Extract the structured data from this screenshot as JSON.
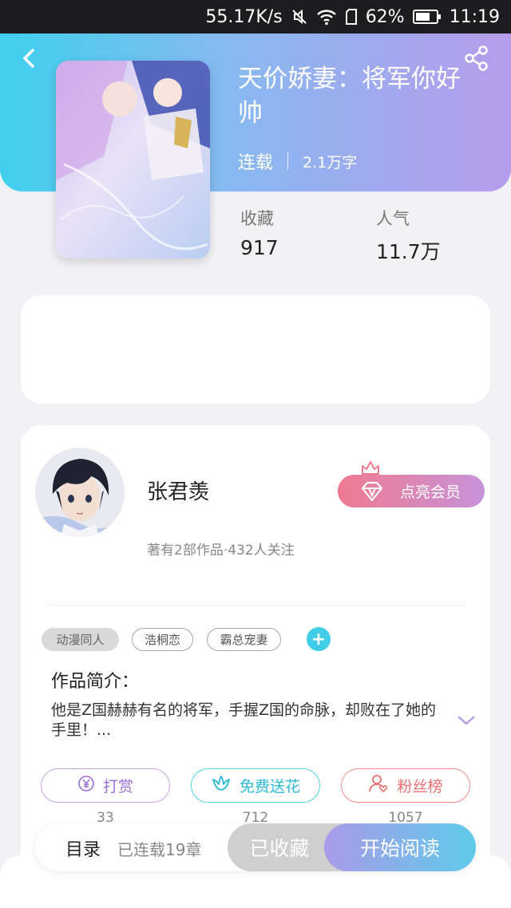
{
  "status_bar": {
    "speed": "55.17K/s",
    "battery_percent": "62%",
    "time": "11:19",
    "icons": [
      "mute-icon",
      "wifi-icon",
      "sim-icon",
      "battery-icon"
    ]
  },
  "header": {
    "back_icon": "back-arrow-icon",
    "share_icon": "share-icon",
    "cover_alt": "将军你好帅"
  },
  "book": {
    "title": "天价娇妻：将军你好帅",
    "status": "连载",
    "word_count": "2.1万字",
    "stats": [
      {
        "label": "收藏",
        "value": "917"
      },
      {
        "label": "人气",
        "value": "11.7万"
      }
    ]
  },
  "author": {
    "name": "张君羡",
    "meta": "著有2部作品·432人关注",
    "vip_button": "点亮会员"
  },
  "tags": [
    "动漫同人",
    "浩桐恋",
    "霸总宠妻"
  ],
  "tag_add": "+",
  "intro": {
    "title": "作品简介：",
    "text": "他是Z国赫赫有名的将军，手握Z国的命脉，却败在了她的手里！..."
  },
  "actions": [
    {
      "label": "打赏",
      "count": "33",
      "icon": "yen-icon"
    },
    {
      "label": "免费送花",
      "count": "712",
      "icon": "flower-icon"
    },
    {
      "label": "粉丝榜",
      "count": "1057",
      "icon": "fans-icon"
    }
  ],
  "bottom_bar": {
    "toc_label": "目录",
    "toc_count": "已连载19章",
    "collected_label": "已收藏",
    "read_label": "开始阅读"
  },
  "colors": {
    "header_gradient_start": "#3fd0ee",
    "header_gradient_end": "#b69cec",
    "accent_cyan": "#3fcde8",
    "vip_gradient_start": "#ef7a90",
    "vip_gradient_end": "#c793d9"
  }
}
